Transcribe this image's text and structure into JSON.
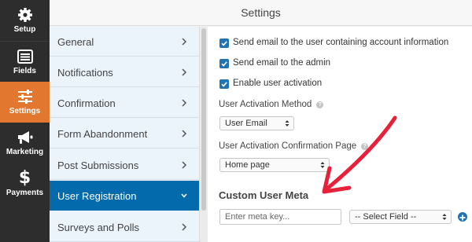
{
  "header": {
    "title": "Settings"
  },
  "rail": {
    "items": [
      {
        "label": "Setup",
        "icon": "gear-icon"
      },
      {
        "label": "Fields",
        "icon": "list-icon"
      },
      {
        "label": "Settings",
        "icon": "sliders-icon",
        "active": true
      },
      {
        "label": "Marketing",
        "icon": "megaphone-icon"
      },
      {
        "label": "Payments",
        "icon": "dollar-icon"
      }
    ]
  },
  "subnav": {
    "items": [
      {
        "label": "General"
      },
      {
        "label": "Notifications"
      },
      {
        "label": "Confirmation"
      },
      {
        "label": "Form Abandonment"
      },
      {
        "label": "Post Submissions"
      },
      {
        "label": "User Registration",
        "active": true
      },
      {
        "label": "Surveys and Polls"
      }
    ]
  },
  "panel": {
    "checkboxes": [
      {
        "label": "Send email to the user containing account information",
        "checked": true
      },
      {
        "label": "Send email to the admin",
        "checked": true
      },
      {
        "label": "Enable user activation",
        "checked": true
      }
    ],
    "activation_method": {
      "label": "User Activation Method",
      "value": "User Email"
    },
    "confirmation_page": {
      "label": "User Activation Confirmation Page",
      "value": "Home page"
    },
    "custom_user_meta": {
      "heading": "Custom User Meta",
      "meta_key_placeholder": "Enter meta key...",
      "field_select_value": "-- Select Field --"
    }
  },
  "colors": {
    "rail_bg": "#2d2d2d",
    "rail_active": "#e27730",
    "subnav_active": "#036aab",
    "checkbox": "#2173b3",
    "annotation_arrow": "#e8213a"
  }
}
